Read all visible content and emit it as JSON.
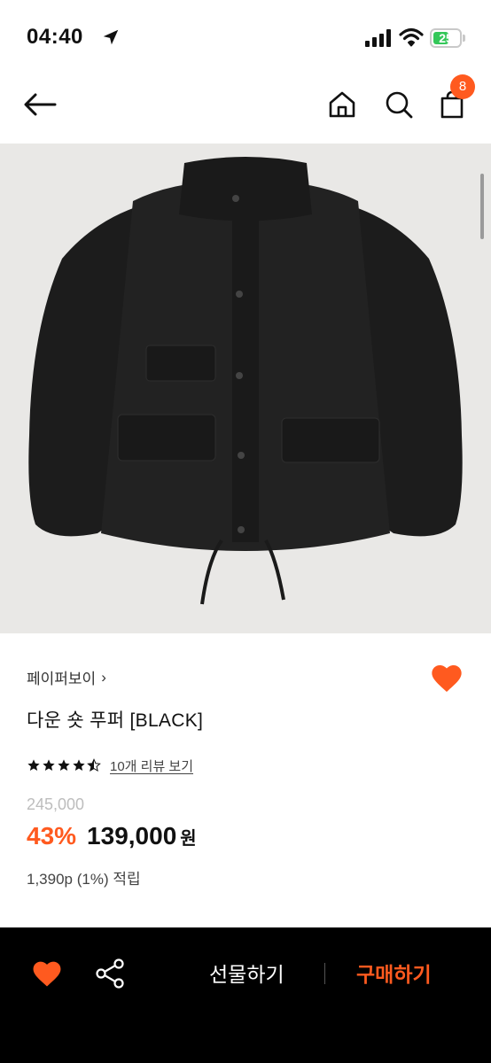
{
  "status_bar": {
    "time": "04:40",
    "battery": "25",
    "battery_level": 0.25,
    "icons": [
      "location-arrow-icon",
      "cellular-signal-icon",
      "wifi-icon",
      "battery-icon"
    ]
  },
  "nav": {
    "icons": [
      "back-arrow-icon",
      "home-icon",
      "search-icon",
      "cart-icon"
    ],
    "cart_count": "8"
  },
  "product": {
    "image": "black down puffer jacket",
    "brand": "페이퍼보이",
    "brand_chevron": "›",
    "title": "다운 숏 푸퍼 [BLACK]",
    "rating": 4.5,
    "review_link": "10개 리뷰 보기",
    "original_price": "245,000",
    "discount": "43%",
    "sale_price": "139,000",
    "currency": "원",
    "points": "1,390p (1%) 적립"
  },
  "bottom_bar": {
    "gift_label": "선물하기",
    "buy_label": "구매하기"
  },
  "colors": {
    "accent": "#ff5a1f",
    "image_bg": "#e9e8e6",
    "bottom_bar_bg": "#000000",
    "battery_green": "#34c759"
  }
}
